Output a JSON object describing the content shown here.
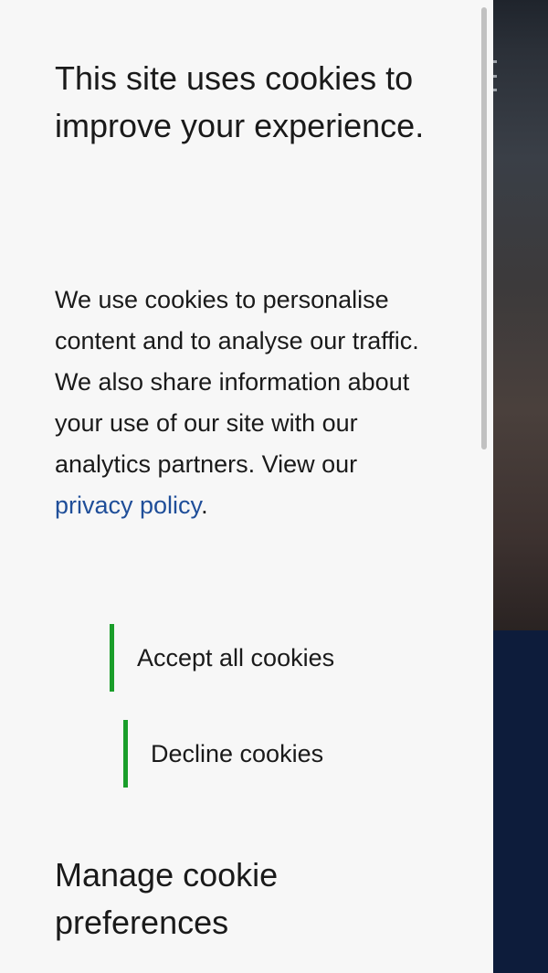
{
  "cookie_banner": {
    "title": "This site uses cookies to improve your experience.",
    "body_text": "We use cookies to personalise content and to analyse our traffic. We also share information about your use of our site with our analytics partners. View our ",
    "privacy_link_label": "privacy policy",
    "body_end": ".",
    "accept_label": "Accept all cookies",
    "decline_label": "Decline cookies",
    "manage_title": "Manage cookie preferences"
  },
  "colors": {
    "panel_background": "#f7f7f7",
    "text": "#1a1a1a",
    "link": "#1f4e99",
    "button_accent": "#1a9e2a",
    "background_footer": "#0d1c3b"
  },
  "background_site": {
    "menu_icon": "hamburger-menu-icon"
  }
}
